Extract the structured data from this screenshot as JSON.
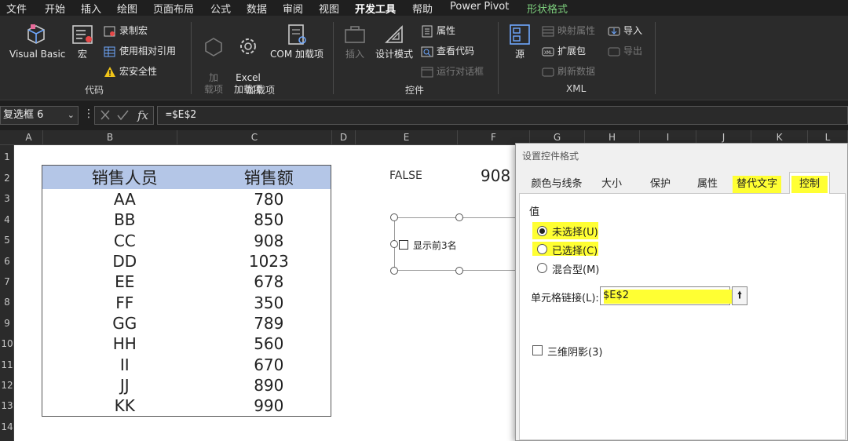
{
  "menu": {
    "items": [
      "文件",
      "开始",
      "插入",
      "绘图",
      "页面布局",
      "公式",
      "数据",
      "审阅",
      "视图",
      "开发工具",
      "帮助",
      "Power Pivot",
      "形状格式"
    ],
    "active": "开发工具"
  },
  "ribbon": {
    "code_group": {
      "label": "代码",
      "visual_basic": "Visual Basic",
      "macros": "宏",
      "record_macro": "录制宏",
      "relative_refs": "使用相对引用",
      "macro_security": "宏安全性"
    },
    "addins_group": {
      "label": "加载项",
      "addins": "加\n载项",
      "excel_addins": "Excel\n加载项",
      "com_addins": "COM 加载项"
    },
    "controls_group": {
      "label": "控件",
      "insert": "插入",
      "design_mode": "设计模式",
      "properties": "属性",
      "view_code": "查看代码",
      "run_dialog": "运行对话框"
    },
    "xml_group": {
      "label": "XML",
      "source": "源",
      "map_properties": "映射属性",
      "expansion_packs": "扩展包",
      "refresh_data": "刷新数据",
      "import": "导入",
      "export": "导出"
    }
  },
  "formula_bar": {
    "name_box": "复选框 6",
    "formula": "=$E$2"
  },
  "grid": {
    "columns": [
      "A",
      "B",
      "C",
      "D",
      "E",
      "F",
      "G",
      "H",
      "I",
      "J",
      "K",
      "L"
    ],
    "rows": [
      "1",
      "2",
      "3",
      "4",
      "5",
      "6",
      "7",
      "8",
      "9",
      "10",
      "11",
      "12",
      "13",
      "14"
    ]
  },
  "table": {
    "headers": [
      "销售人员",
      "销售额"
    ],
    "rows": [
      [
        "AA",
        "780"
      ],
      [
        "BB",
        "850"
      ],
      [
        "CC",
        "908"
      ],
      [
        "DD",
        "1023"
      ],
      [
        "EE",
        "678"
      ],
      [
        "FF",
        "350"
      ],
      [
        "GG",
        "789"
      ],
      [
        "HH",
        "560"
      ],
      [
        "II",
        "670"
      ],
      [
        "JJ",
        "890"
      ],
      [
        "KK",
        "990"
      ]
    ]
  },
  "cells": {
    "e2": "FALSE",
    "f2": "908"
  },
  "checkbox_control": {
    "label": "显示前3名"
  },
  "dialog": {
    "title": "设置控件格式",
    "tabs": [
      "颜色与线条",
      "大小",
      "保护",
      "属性",
      "替代文字",
      "控制"
    ],
    "selected_tab": "控制",
    "value_group_label": "值",
    "options": [
      "未选择(U)",
      "已选择(C)",
      "混合型(M)"
    ],
    "selected_option": "未选择(U)",
    "cell_link_label": "单元格链接(L):",
    "cell_link_value": "$E$2",
    "shading_label": "三维阴影(3)",
    "highlight_color": "#ffff33"
  }
}
